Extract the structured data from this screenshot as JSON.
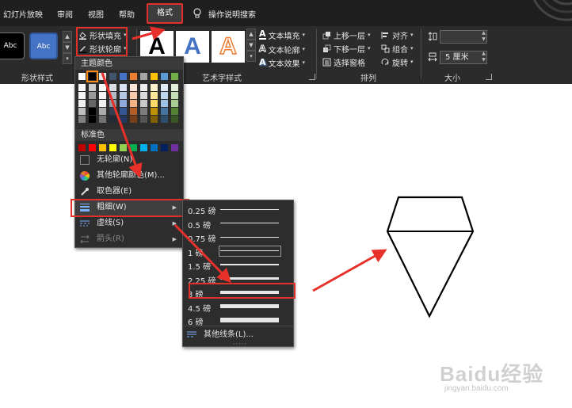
{
  "tabs": {
    "slideshow": "幻灯片放映",
    "review": "审阅",
    "view": "视图",
    "help": "帮助",
    "format": "格式",
    "tell_me": "操作说明搜索"
  },
  "ribbon": {
    "shape_styles": {
      "group_label": "形状样式",
      "style_1": "Abc",
      "style_2": "Abc",
      "fill": "形状填充",
      "outline": "形状轮廓"
    },
    "wordart": {
      "group_label": "艺术字样式",
      "letter": "A",
      "text_fill": "文本填充",
      "text_outline": "文本轮廓",
      "text_effects": "文本效果"
    },
    "arrange": {
      "group_label": "排列",
      "bring_forward": "上移一层",
      "send_backward": "下移一层",
      "selection_pane": "选择窗格",
      "align": "对齐",
      "group": "组合",
      "rotate": "旋转"
    },
    "size": {
      "group_label": "大小",
      "height_value": "",
      "width_value": "5 厘米"
    }
  },
  "color_menu": {
    "theme_colors_header": "主题颜色",
    "standard_colors_header": "标准色",
    "theme_colors": [
      "#ffffff",
      "#000000",
      "#e7e6e6",
      "#44546a",
      "#4472c4",
      "#ed7d31",
      "#a5a5a5",
      "#ffc000",
      "#5b9bd5",
      "#70ad47"
    ],
    "standard_colors": [
      "#c00000",
      "#ff0000",
      "#ffc000",
      "#ffff00",
      "#92d050",
      "#00b050",
      "#00b0f0",
      "#0070c0",
      "#002060",
      "#7030a0"
    ],
    "no_outline": "无轮廓(N)",
    "more_colors": "其他轮廓颜色(M)...",
    "eyedropper": "取色器(E)",
    "weight": "粗细(W)",
    "dashes": "虚线(S)",
    "arrows": "箭头(R)"
  },
  "weight_menu": {
    "items": [
      {
        "label": "0.25 磅",
        "pt": 0.25
      },
      {
        "label": "0.5 磅",
        "pt": 0.5
      },
      {
        "label": "0.75 磅",
        "pt": 0.75
      },
      {
        "label": "1 磅",
        "pt": 1
      },
      {
        "label": "1.5 磅",
        "pt": 1.5
      },
      {
        "label": "2.25 磅",
        "pt": 2.25
      },
      {
        "label": "3 磅",
        "pt": 3
      },
      {
        "label": "4.5 磅",
        "pt": 4.5
      },
      {
        "label": "6 磅",
        "pt": 6
      }
    ],
    "more_lines": "其他线条(L)..."
  },
  "watermark": {
    "brand": "Baidu经验",
    "url": "jingyan.baidu.com"
  },
  "colors": {
    "highlight_red": "#e0312a",
    "ribbon_bg": "#2b2b2b",
    "menu_bg": "#2d2d2d"
  }
}
